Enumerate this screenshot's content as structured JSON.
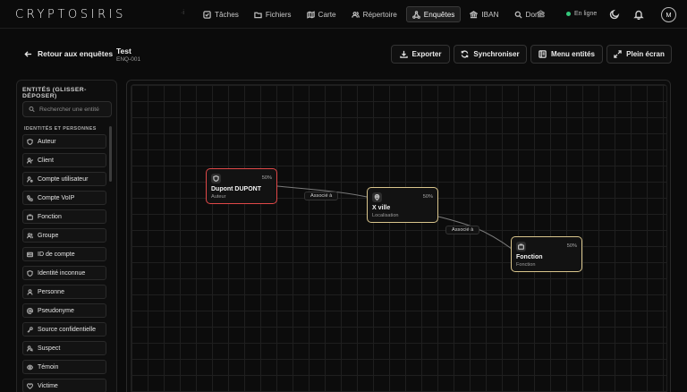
{
  "app": {
    "logo": "CRYPTOSIRIS",
    "separator": "·i"
  },
  "nav": [
    {
      "label": "Tâches",
      "icon": "check-square-icon"
    },
    {
      "label": "Fichiers",
      "icon": "folder-icon"
    },
    {
      "label": "Carte",
      "icon": "map-icon"
    },
    {
      "label": "Répertoire",
      "icon": "users-icon"
    },
    {
      "label": "Enquêtes",
      "icon": "network-icon",
      "active": true
    },
    {
      "label": "IBAN",
      "icon": "bank-icon"
    },
    {
      "label": "Dorks",
      "icon": "search-icon"
    }
  ],
  "status": {
    "label": "En ligne",
    "color": "#34c77b"
  },
  "user": {
    "initial": "M"
  },
  "header": {
    "back_label": "Retour aux enquêtes",
    "case_title": "Test",
    "case_id": "ENQ-001",
    "buttons": {
      "export": "Exporter",
      "sync": "Synchroniser",
      "entities_menu": "Menu entités",
      "fullscreen": "Plein écran"
    }
  },
  "sidebar": {
    "title": "ENTITÉS (GLISSER-DÉPOSER)",
    "search_placeholder": "Rechercher une entité",
    "section": "IDENTITÉS ET PERSONNES",
    "items": [
      {
        "label": "Auteur",
        "icon": "shield-user-icon"
      },
      {
        "label": "Client",
        "icon": "user-check-icon"
      },
      {
        "label": "Compte utilisateur",
        "icon": "user-cog-icon"
      },
      {
        "label": "Compte VoIP",
        "icon": "phone-icon"
      },
      {
        "label": "Fonction",
        "icon": "briefcase-icon"
      },
      {
        "label": "Groupe",
        "icon": "users-icon"
      },
      {
        "label": "ID de compte",
        "icon": "id-card-icon"
      },
      {
        "label": "Identité inconnue",
        "icon": "shield-icon"
      },
      {
        "label": "Personne",
        "icon": "user-icon"
      },
      {
        "label": "Pseudonyme",
        "icon": "at-sign-icon"
      },
      {
        "label": "Source confidentielle",
        "icon": "key-icon"
      },
      {
        "label": "Suspect",
        "icon": "user-search-icon"
      },
      {
        "label": "Témoin",
        "icon": "eye-icon"
      },
      {
        "label": "Victime",
        "icon": "heart-icon"
      }
    ]
  },
  "graph": {
    "nodes": [
      {
        "id": "n1",
        "title": "Dupont DUPONT",
        "subtitle": "Auteur",
        "percent": "50%",
        "icon": "shield-user-icon",
        "accent": "#e04848"
      },
      {
        "id": "n2",
        "title": "X ville",
        "subtitle": "Localisation",
        "percent": "50%",
        "icon": "map-pin-icon",
        "accent": "#d9c58c"
      },
      {
        "id": "n3",
        "title": "Fonction",
        "subtitle": "Fonction",
        "percent": "50%",
        "icon": "briefcase-icon",
        "accent": "#d9c58c"
      }
    ],
    "edges": [
      {
        "from": "n1",
        "to": "n2",
        "label": "Associé à"
      },
      {
        "from": "n2",
        "to": "n3",
        "label": "Associé à"
      }
    ]
  },
  "colors": {
    "background": "#0b0b0b",
    "accent_gold": "#d9c58c",
    "accent_red": "#e04848"
  }
}
